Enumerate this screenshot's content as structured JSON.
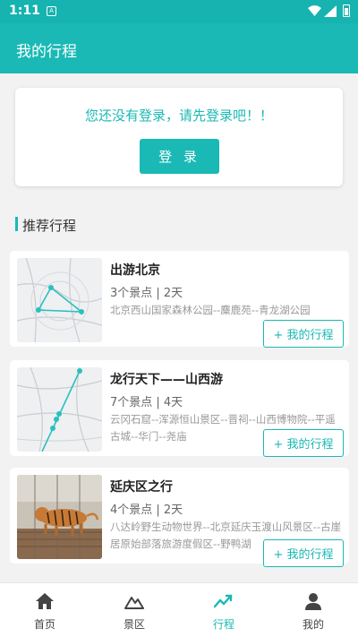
{
  "status_bar": {
    "time": "1:11",
    "notification_letter": "A"
  },
  "app_bar": {
    "title": "我的行程"
  },
  "login_card": {
    "prompt": "您还没有登录，请先登录吧！！",
    "button_label": "登 录"
  },
  "section": {
    "title": "推荐行程"
  },
  "trips": [
    {
      "name": "出游北京",
      "meta": "3个景点 | 2天",
      "route": "北京西山国家森林公园--麋鹿苑--青龙湖公园",
      "button_label": "+ 我的行程",
      "thumbnail": "map-thumbnail"
    },
    {
      "name": "龙行天下——山西游",
      "meta": "7个景点 | 4天",
      "route": "云冈石窟--浑源恒山景区--晋祠--山西博物院--平遥古城--华门--尧庙",
      "button_label": "+ 我的行程",
      "thumbnail": "map-thumbnail"
    },
    {
      "name": "延庆区之行",
      "meta": "4个景点 | 2天",
      "route": "八达岭野生动物世界--北京延庆玉渡山风景区--古崖居原始部落旅游度假区--野鸭湖",
      "button_label": "+ 我的行程",
      "thumbnail": "tiger-photo"
    }
  ],
  "bottom_nav": [
    {
      "label": "首页",
      "icon": "home-icon",
      "active": false
    },
    {
      "label": "景区",
      "icon": "mountain-icon",
      "active": false
    },
    {
      "label": "行程",
      "icon": "trend-icon",
      "active": true
    },
    {
      "label": "我的",
      "icon": "person-icon",
      "active": false
    }
  ],
  "colors": {
    "accent": "#1ab9b5",
    "background": "#f2f2f2"
  }
}
